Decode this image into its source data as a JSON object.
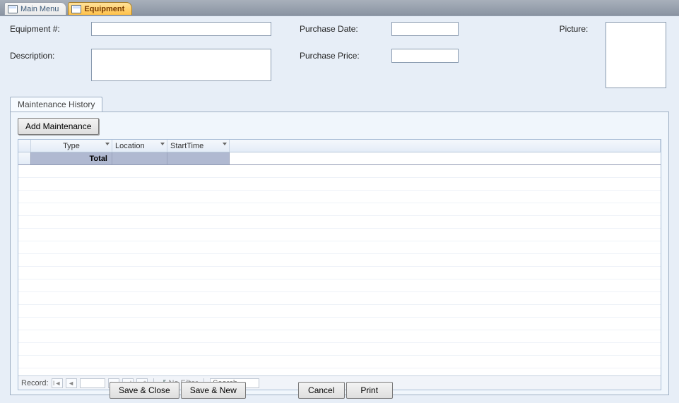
{
  "tabs": {
    "main_menu": "Main Menu",
    "equipment": "Equipment"
  },
  "fields": {
    "equip_num_label": "Equipment #:",
    "desc_label": "Description:",
    "purchase_date_label": "Purchase Date:",
    "purchase_price_label": "Purchase Price:",
    "picture_label": "Picture:",
    "equip_num_value": "",
    "desc_value": "",
    "purchase_date_value": "",
    "purchase_price_value": ""
  },
  "tabctrl": {
    "maintenance_tab": "Maintenance History",
    "add_button": "Add Maintenance"
  },
  "grid": {
    "columns": {
      "type": "Type",
      "location": "Location",
      "starttime": "StartTime"
    },
    "total_label": "Total"
  },
  "recnav": {
    "label": "Record:",
    "position": "",
    "no_filter": "No Filter",
    "search_placeholder": "Search"
  },
  "buttons": {
    "save_close": "Save & Close",
    "save_new": "Save & New",
    "cancel": "Cancel",
    "print": "Print"
  }
}
